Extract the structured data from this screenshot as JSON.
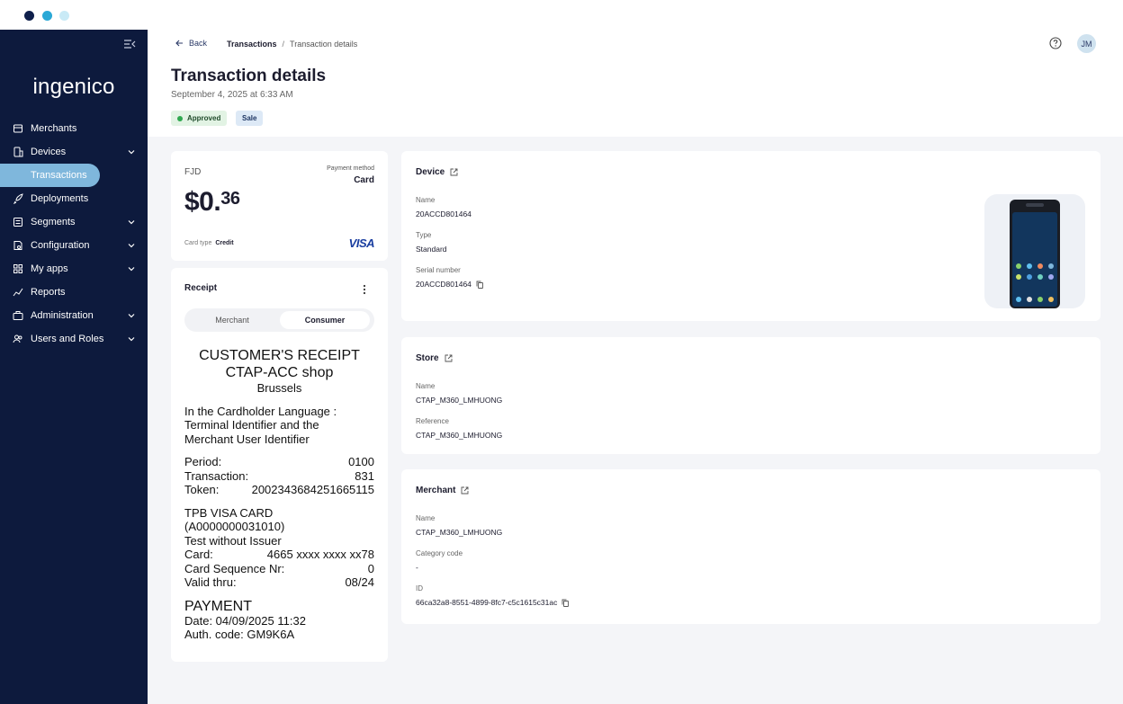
{
  "sidebar": {
    "logo": "ingenico",
    "items": [
      {
        "label": "Merchants"
      },
      {
        "label": "Devices"
      },
      {
        "label": "Transactions"
      },
      {
        "label": "Deployments"
      },
      {
        "label": "Segments"
      },
      {
        "label": "Configuration"
      },
      {
        "label": "My apps"
      },
      {
        "label": "Reports"
      },
      {
        "label": "Administration"
      },
      {
        "label": "Users and Roles"
      }
    ]
  },
  "header": {
    "back": "Back",
    "breadcrumb": [
      "Transactions",
      "/",
      "Transaction details"
    ],
    "avatar": "JM",
    "title": "Transaction details",
    "subtitle": "September 4, 2025 at 6:33 AM",
    "badges": [
      "Approved",
      "Sale"
    ]
  },
  "summary": {
    "currency": "FJD",
    "payment_method_label": "Payment method",
    "payment_method": "Card",
    "amount_main": "$0.",
    "amount_cents": "36",
    "card_type_label": "Card type",
    "card_type": "Credit",
    "brand": "VISA"
  },
  "receipt": {
    "title": "Receipt",
    "tabs": [
      "Merchant",
      "Consumer"
    ],
    "lines": {
      "h1": "CUSTOMER'S RECEIPT",
      "h2": "CTAP-ACC shop",
      "city": "Brussels",
      "lang1": "In the Cardholder Language :",
      "lang2": "Terminal Identifier and the",
      "lang3": "Merchant User Identifier",
      "period_k": "Period:",
      "period_v": "0100",
      "trans_k": "Transaction:",
      "trans_v": "831",
      "token_k": "Token:",
      "token_v": "2002343684251665115",
      "card1": "TPB VISA CARD",
      "card2": "(A0000000031010)",
      "card3": "Test without Issuer",
      "card_k": "Card:",
      "card_v": "4665 xxxx xxxx xx78",
      "seq_k": "Card Sequence Nr:",
      "seq_v": "0",
      "valid_k": "Valid thru:",
      "valid_v": "08/24",
      "payment": "PAYMENT",
      "date": "Date: 04/09/2025 11:32",
      "auth": "Auth. code: GM9K6A"
    }
  },
  "device": {
    "title": "Device",
    "name_label": "Name",
    "name": "20ACCD801464",
    "type_label": "Type",
    "type": "Standard",
    "serial_label": "Serial number",
    "serial": "20ACCD801464"
  },
  "store": {
    "title": "Store",
    "name_label": "Name",
    "name": "CTAP_M360_LMHUONG",
    "ref_label": "Reference",
    "ref": "CTAP_M360_LMHUONG"
  },
  "merchant": {
    "title": "Merchant",
    "name_label": "Name",
    "name": "CTAP_M360_LMHUONG",
    "cat_label": "Category code",
    "cat": "-",
    "id_label": "ID",
    "id": "66ca32a8-8551-4899-8fc7-c5c1615c31ac"
  },
  "colors": {
    "sidebar_bg": "#0d1a3d",
    "active_item": "#7fb7dc",
    "approved_dot": "#2fa84f",
    "visa_blue": "#1a3ea0"
  }
}
